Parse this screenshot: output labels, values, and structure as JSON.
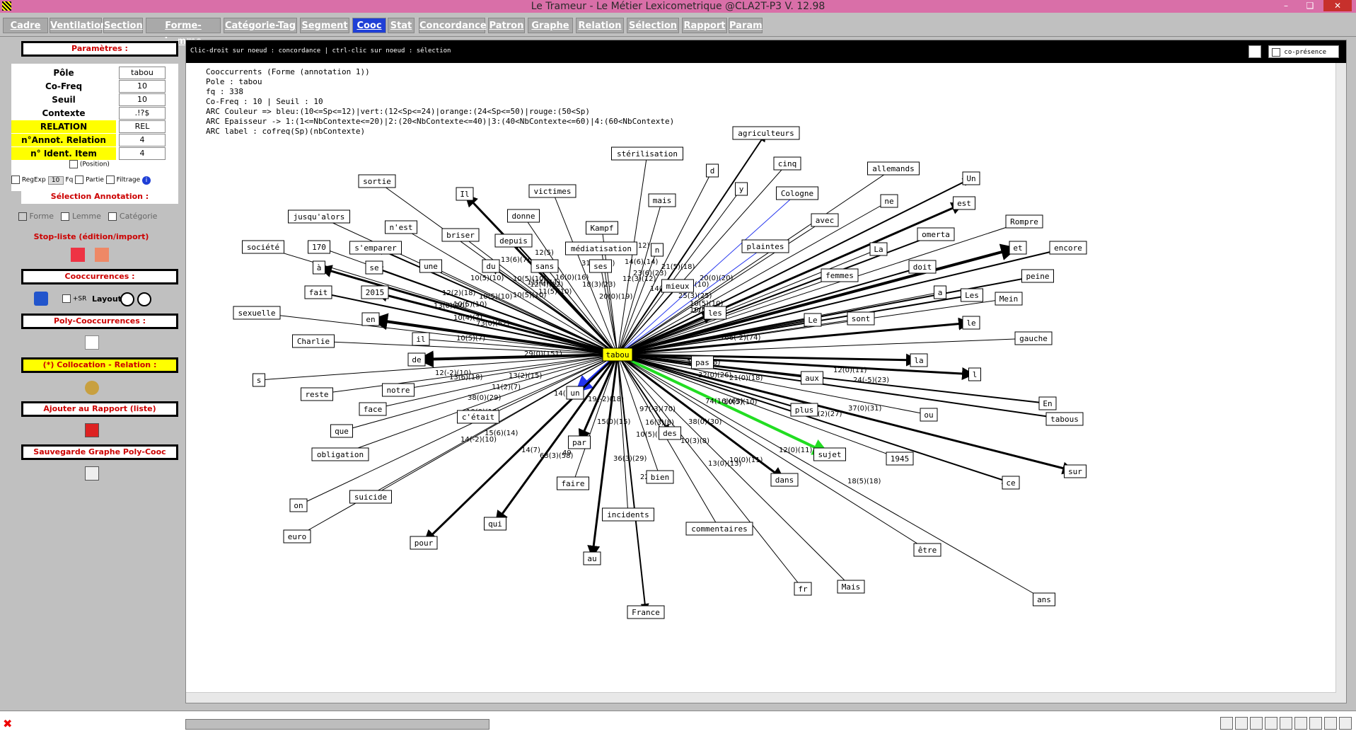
{
  "app": {
    "title": "Le Trameur - Le Métier Lexicometrique @CLA2T-P3 V. 12.98"
  },
  "tabs": [
    {
      "label": "Cadre",
      "active": false
    },
    {
      "label": "Ventilation",
      "active": false
    },
    {
      "label": "Section",
      "active": false
    },
    {
      "label": "Forme-Lemme",
      "active": false
    },
    {
      "label": "Catégorie-Tag",
      "active": false
    },
    {
      "label": "Segment",
      "active": false
    },
    {
      "label": "Cooc",
      "active": true
    },
    {
      "label": "Stat",
      "active": false
    },
    {
      "label": "Concordance",
      "active": false
    },
    {
      "label": "Patron",
      "active": false
    },
    {
      "label": "Graphe",
      "active": false
    },
    {
      "label": "Relation",
      "active": false
    },
    {
      "label": "Sélection",
      "active": false
    },
    {
      "label": "Rapport",
      "active": false
    },
    {
      "label": "Param",
      "active": false
    }
  ],
  "left": {
    "parametres_title": "Paramètres :",
    "params": [
      {
        "label": "Pôle",
        "value": "tabou",
        "highlight": false
      },
      {
        "label": "Co-Freq",
        "value": "10",
        "highlight": false
      },
      {
        "label": "Seuil",
        "value": "10",
        "highlight": false
      },
      {
        "label": "Contexte",
        "value": ".!?$",
        "highlight": false
      },
      {
        "label": "RELATION",
        "value": "REL",
        "highlight": true
      },
      {
        "label": "n°Annot. Relation",
        "value": "4",
        "highlight": true
      },
      {
        "label": "n° Ident. Item",
        "value": "4",
        "highlight": true
      }
    ],
    "position_label": "(Position)",
    "regexp_label": "RegExp",
    "regexp_value": "10",
    "fq_label": "Fq",
    "partie_label": "Partie",
    "filtrage_label": "Filtrage",
    "selection_annotation_title": "Sélection Annotation :",
    "forme_label": "Forme",
    "lemme_label": "Lemme",
    "categorie_label": "Catégorie",
    "stopliste_label": "Stop-liste (édition/import)",
    "cooccurrences_title": "Cooccurrences :",
    "sr_label": "+SR",
    "layout_label": "Layout",
    "poly_cooc_title": "Poly-Cooccurrences :",
    "collocation_title": "(*) Collocation - Relation :",
    "ajouter_title": "Ajouter au Rapport (liste)",
    "sauvegarde_title": "Sauvegarde Graphe Poly-Cooc"
  },
  "graph": {
    "hint": "Clic-droit sur noeud : concordance | ctrl-clic sur noeud : sélection",
    "copresence_label": "co-présence",
    "info_lines": [
      "Cooccurrents (Forme (annotation 1))",
      "Pole : tabou",
      "fq : 338",
      "Co-Freq : 10 | Seuil : 10",
      "ARC Couleur => bleu:(10<=Sp<=12)|vert:(12<Sp<=24)|orange:(24<Sp<=50)|rouge:(50<Sp)",
      "ARC Epaisseur -> 1:(1<=NbContexte<=20)|2:(20<NbContexte<=40)|3:(40<NbContexte<=60)|4:(60<NbContexte)",
      "ARC label : cofreq(Sp)(nbContexte)"
    ],
    "center": "tabou",
    "nodes": [
      {
        "w": "agriculteurs"
      },
      {
        "w": "stérilisation"
      },
      {
        "w": "cinq"
      },
      {
        "w": "d"
      },
      {
        "w": "allemands"
      },
      {
        "w": "sortie"
      },
      {
        "w": "y"
      },
      {
        "w": "Un"
      },
      {
        "w": "Il"
      },
      {
        "w": "victimes"
      },
      {
        "w": "Cologne"
      },
      {
        "w": "mais"
      },
      {
        "w": "ne"
      },
      {
        "w": "est"
      },
      {
        "w": "donne"
      },
      {
        "w": "jusqu'alors"
      },
      {
        "w": "avec"
      },
      {
        "w": "n'est"
      },
      {
        "w": "Kampf"
      },
      {
        "w": "Rompre"
      },
      {
        "w": "briser"
      },
      {
        "w": "omerta"
      },
      {
        "w": "depuis"
      },
      {
        "w": "plaintes"
      },
      {
        "w": "société"
      },
      {
        "w": "170"
      },
      {
        "w": "s'emparer"
      },
      {
        "w": "médiatisation"
      },
      {
        "w": "n"
      },
      {
        "w": "La"
      },
      {
        "w": "et"
      },
      {
        "w": "encore"
      },
      {
        "w": "une"
      },
      {
        "w": "du"
      },
      {
        "w": "sans"
      },
      {
        "w": "ses"
      },
      {
        "w": "à"
      },
      {
        "w": "se"
      },
      {
        "w": "doit"
      },
      {
        "w": "peine"
      },
      {
        "w": "femmes"
      },
      {
        "w": "mieux"
      },
      {
        "w": "fait"
      },
      {
        "w": "2015"
      },
      {
        "w": "a"
      },
      {
        "w": "Les"
      },
      {
        "w": "Mein"
      },
      {
        "w": "sexuelle"
      },
      {
        "w": "les"
      },
      {
        "w": "sont"
      },
      {
        "w": "en"
      },
      {
        "w": "Le"
      },
      {
        "w": "le"
      },
      {
        "w": "il"
      },
      {
        "w": "gauche"
      },
      {
        "w": "Charlie"
      },
      {
        "w": "de"
      },
      {
        "w": "la"
      },
      {
        "w": "pas"
      },
      {
        "w": "l"
      },
      {
        "w": "aux"
      },
      {
        "w": "s"
      },
      {
        "w": "notre"
      },
      {
        "w": "reste"
      },
      {
        "w": "En"
      },
      {
        "w": "un"
      },
      {
        "w": "face"
      },
      {
        "w": "plus"
      },
      {
        "w": "ou"
      },
      {
        "w": "tabous"
      },
      {
        "w": "c'était"
      },
      {
        "w": "que"
      },
      {
        "w": "des"
      },
      {
        "w": "par"
      },
      {
        "w": "obligation"
      },
      {
        "w": "sujet"
      },
      {
        "w": "1945"
      },
      {
        "w": "sur"
      },
      {
        "w": "bien"
      },
      {
        "w": "faire"
      },
      {
        "w": "ce"
      },
      {
        "w": "dans"
      },
      {
        "w": "suicide"
      },
      {
        "w": "on"
      },
      {
        "w": "incidents"
      },
      {
        "w": "qui"
      },
      {
        "w": "commentaires"
      },
      {
        "w": "euro"
      },
      {
        "w": "pour"
      },
      {
        "w": "être"
      },
      {
        "w": "au"
      },
      {
        "w": "Mais"
      },
      {
        "w": "fr"
      },
      {
        "w": "ans"
      },
      {
        "w": "France"
      }
    ],
    "edge_labels": [
      {
        "t": "13(6)(7)"
      },
      {
        "t": "12(5)"
      },
      {
        "t": "31(7)(23)"
      },
      {
        "t": "13(3)(12)"
      },
      {
        "t": "14(6)(14)"
      },
      {
        "t": "23(6)(23)"
      },
      {
        "t": "10(5)(10)"
      },
      {
        "t": "12(3)(12)"
      },
      {
        "t": "21(5)(18)"
      },
      {
        "t": "11(4)(11)"
      },
      {
        "t": "10(5)(10)"
      },
      {
        "t": "12(4)(12)"
      },
      {
        "t": "11(5)(10)"
      },
      {
        "t": "18(3)(23)"
      },
      {
        "t": "20(0)(19)"
      },
      {
        "t": "16(0)(16)"
      },
      {
        "t": "20(0)(20)"
      },
      {
        "t": "14(9)(60)"
      },
      {
        "t": "10(5)(10)"
      },
      {
        "t": "10(5)(10)"
      },
      {
        "t": "12(2)(18)"
      },
      {
        "t": "10(5)(10)"
      },
      {
        "t": "10(5)(10)"
      },
      {
        "t": "25(3)(25)"
      },
      {
        "t": "10(5)(10)"
      },
      {
        "t": "10(5)(10)"
      },
      {
        "t": "13(0)(10)"
      },
      {
        "t": "27(0)(26)"
      },
      {
        "t": "10(4)(7)"
      },
      {
        "t": "73(0)(62)"
      },
      {
        "t": "10(5)(7)"
      },
      {
        "t": "166(-2)(74)"
      },
      {
        "t": "29(0)(151)"
      },
      {
        "t": "12(-2)(10)"
      },
      {
        "t": "13(2)(15)"
      },
      {
        "t": "11(2)(7)"
      },
      {
        "t": "13(6)(18)"
      },
      {
        "t": "16(3)(18)"
      },
      {
        "t": "32(0)(26)"
      },
      {
        "t": "21(0)(18)"
      },
      {
        "t": "12(0)(11)"
      },
      {
        "t": "24(-5)(23)"
      },
      {
        "t": "14(7)"
      },
      {
        "t": "38(0)(29)"
      },
      {
        "t": "19(-2)(18)"
      },
      {
        "t": "97(-3)(70)"
      },
      {
        "t": "74(16)(63)"
      },
      {
        "t": "10(5)(10)"
      },
      {
        "t": "37(0)(31)"
      },
      {
        "t": "30(2)(27)"
      },
      {
        "t": "10(0)(10)"
      },
      {
        "t": "15(6)(14)"
      },
      {
        "t": "14(-2)(10)"
      },
      {
        "t": "15(0)(15)"
      },
      {
        "t": "16(3)(8)"
      },
      {
        "t": "38(0)(30)"
      },
      {
        "t": "10(5)(10)"
      },
      {
        "t": "10(3)(8)"
      },
      {
        "t": "49"
      },
      {
        "t": "14(7)"
      },
      {
        "t": "63(3)(58)"
      },
      {
        "t": "36(3)(29)"
      },
      {
        "t": "22"
      },
      {
        "t": "13(0)(13)"
      },
      {
        "t": "10(0)(11)"
      },
      {
        "t": "12(0)(11)"
      },
      {
        "t": "18(5)(18)"
      }
    ]
  },
  "colors": {
    "title_bar": "#d96fa8",
    "tab_active": "#1f3fd6",
    "tab_inactive": "#a9a9a9",
    "center_node": "#ffff00",
    "edge_blue": "#2233ee",
    "edge_green": "#22dd22"
  }
}
